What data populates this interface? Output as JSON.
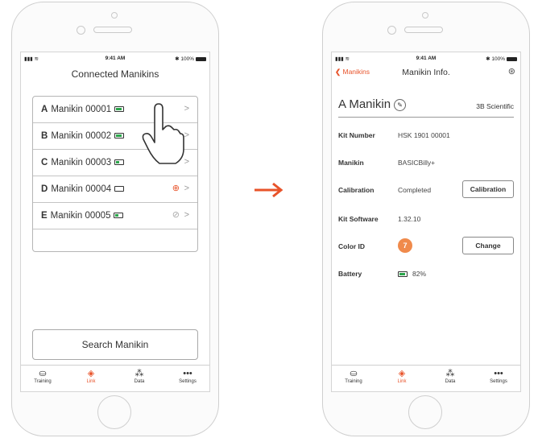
{
  "left_phone": {
    "status": {
      "time": "9:41 AM",
      "battery": "100%"
    },
    "title": "Connected Manikins",
    "manikins": [
      {
        "letter": "A",
        "name": "Manikin 00001",
        "battery_level": 0.9,
        "status_icon": ""
      },
      {
        "letter": "B",
        "name": "Manikin 00002",
        "battery_level": 0.9,
        "status_icon": ""
      },
      {
        "letter": "C",
        "name": "Manikin 00003",
        "battery_level": 0.5,
        "status_icon": ""
      },
      {
        "letter": "D",
        "name": "Manikin 00004",
        "battery_level": 0.0,
        "status_icon": "target-icon"
      },
      {
        "letter": "E",
        "name": "Manikin 00005",
        "battery_level": 0.5,
        "status_icon": "no-signal-icon"
      }
    ],
    "search_button": "Search Manikin",
    "tabs": [
      {
        "label": "Training",
        "icon": "training-icon"
      },
      {
        "label": "Link",
        "icon": "link-icon",
        "active": true
      },
      {
        "label": "Data",
        "icon": "data-icon"
      },
      {
        "label": "Settings",
        "icon": "settings-icon"
      }
    ]
  },
  "right_phone": {
    "status": {
      "time": "9:41 AM",
      "battery": "100%"
    },
    "back_label": "Manikins",
    "title": "Manikin Info.",
    "manikin_name": "A Manikin",
    "brand": "3B Scientific",
    "fields": {
      "kit_number": {
        "label": "Kit Number",
        "value": "HSK 1901 00001"
      },
      "manikin": {
        "label": "Manikin",
        "value": "BASICBilly+"
      },
      "calibration": {
        "label": "Calibration",
        "value": "Completed",
        "button": "Calibration"
      },
      "kit_software": {
        "label": "Kit Software",
        "value": "1.32.10"
      },
      "color_id": {
        "label": "Color ID",
        "value": "7",
        "button": "Change"
      },
      "battery": {
        "label": "Battery",
        "value": "82%"
      }
    },
    "tabs": [
      {
        "label": "Training",
        "icon": "training-icon"
      },
      {
        "label": "Link",
        "icon": "link-icon",
        "active": true
      },
      {
        "label": "Data",
        "icon": "data-icon"
      },
      {
        "label": "Settings",
        "icon": "settings-icon"
      }
    ]
  },
  "colors": {
    "accent": "#e8532a",
    "battery_green": "#2aa64a",
    "color_id": "#f08a4b"
  }
}
